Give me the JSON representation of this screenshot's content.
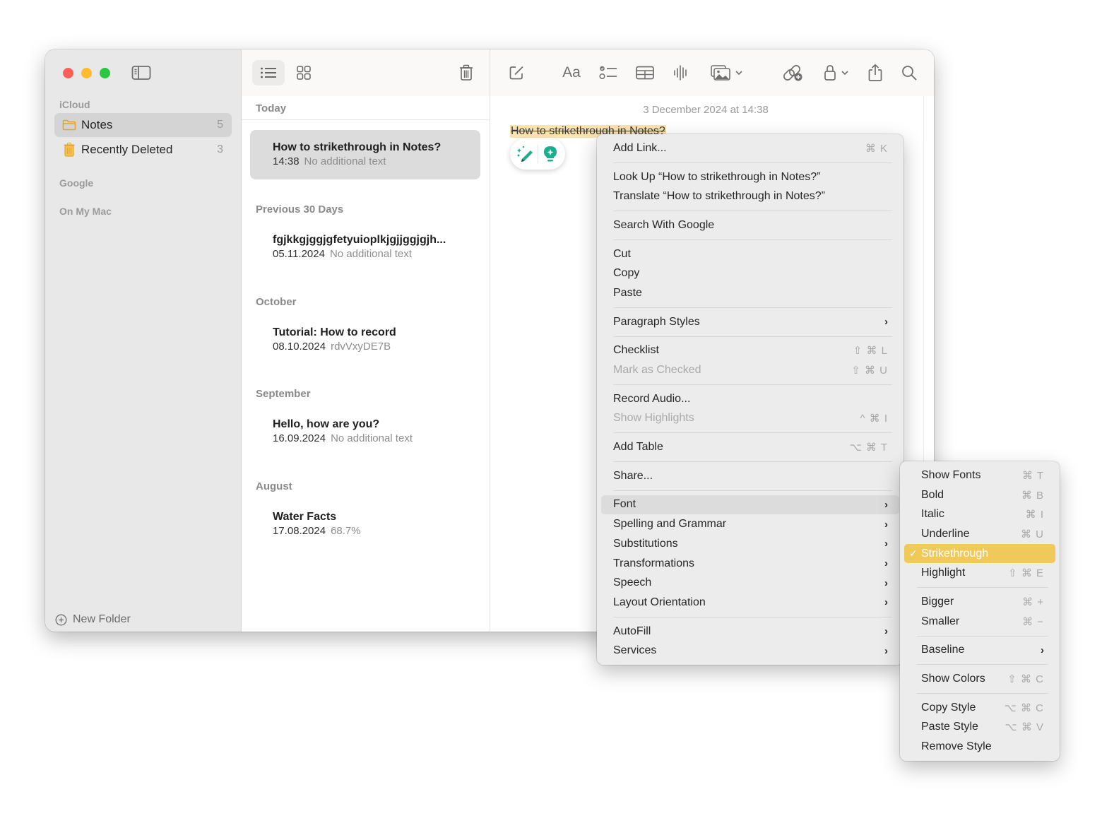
{
  "window": {
    "traffic_lights": [
      "close",
      "minimize",
      "zoom"
    ]
  },
  "sidebar": {
    "sections": [
      {
        "label": "iCloud"
      },
      {
        "label": "Google"
      },
      {
        "label": "On My Mac"
      }
    ],
    "items": [
      {
        "label": "Notes",
        "count": "5",
        "icon": "folder-icon",
        "selected": true
      },
      {
        "label": "Recently Deleted",
        "count": "3",
        "icon": "trash-icon",
        "selected": false
      }
    ],
    "new_folder_label": "New Folder"
  },
  "note_list": {
    "groups": [
      {
        "header": "Today",
        "notes": [
          {
            "title": "How to strikethrough in Notes?",
            "date": "14:38",
            "preview": "No additional text",
            "selected": true
          }
        ]
      },
      {
        "header": "Previous 30 Days",
        "notes": [
          {
            "title": "fgjkkgjggjgfetyuioplkjgjjggjgjh...",
            "date": "05.11.2024",
            "preview": "No additional text"
          }
        ]
      },
      {
        "header": "October",
        "notes": [
          {
            "title": "Tutorial: How to record",
            "date": "08.10.2024",
            "preview": "rdvVxyDE7B"
          }
        ]
      },
      {
        "header": "September",
        "notes": [
          {
            "title": "Hello, how are you?",
            "date": "16.09.2024",
            "preview": "No additional text"
          }
        ]
      },
      {
        "header": "August",
        "notes": [
          {
            "title": "Water Facts",
            "date": "17.08.2024",
            "preview": "68.7%"
          }
        ]
      }
    ]
  },
  "editor": {
    "timestamp": "3 December 2024 at 14:38",
    "body_title": "How to strikethrough in Notes?",
    "highlight_color": "#fbe3b0",
    "writing_tools_color": "#1aae8f"
  },
  "context_menu": {
    "groups": [
      [
        {
          "label": "Add Link...",
          "shortcut": "⌘ K"
        }
      ],
      [
        {
          "label": "Look Up “How to strikethrough in Notes?”"
        },
        {
          "label": "Translate “How to strikethrough in Notes?”"
        }
      ],
      [
        {
          "label": "Search With Google"
        }
      ],
      [
        {
          "label": "Cut"
        },
        {
          "label": "Copy"
        },
        {
          "label": "Paste"
        }
      ],
      [
        {
          "label": "Paragraph Styles",
          "submenu": true
        }
      ],
      [
        {
          "label": "Checklist",
          "shortcut": "⇧ ⌘ L"
        },
        {
          "label": "Mark as Checked",
          "shortcut": "⇧ ⌘ U",
          "disabled": true
        }
      ],
      [
        {
          "label": "Record Audio..."
        },
        {
          "label": "Show Highlights",
          "shortcut": "^ ⌘ I",
          "disabled": true
        }
      ],
      [
        {
          "label": "Add Table",
          "shortcut": "⌥ ⌘ T"
        }
      ],
      [
        {
          "label": "Share..."
        }
      ],
      [
        {
          "label": "Font",
          "submenu": true,
          "hover": true
        },
        {
          "label": "Spelling and Grammar",
          "submenu": true
        },
        {
          "label": "Substitutions",
          "submenu": true
        },
        {
          "label": "Transformations",
          "submenu": true
        },
        {
          "label": "Speech",
          "submenu": true
        },
        {
          "label": "Layout Orientation",
          "submenu": true
        }
      ],
      [
        {
          "label": "AutoFill",
          "submenu": true
        },
        {
          "label": "Services",
          "submenu": true
        }
      ]
    ]
  },
  "font_submenu": {
    "highlight_color": "#f0c95b",
    "groups": [
      [
        {
          "label": "Show Fonts",
          "shortcut": "⌘ T"
        },
        {
          "label": "Bold",
          "shortcut": "⌘ B"
        },
        {
          "label": "Italic",
          "shortcut": "⌘ I"
        },
        {
          "label": "Underline",
          "shortcut": "⌘ U"
        },
        {
          "label": "Strikethrough",
          "checked": true,
          "highlighted": true
        },
        {
          "label": "Highlight",
          "shortcut": "⇧ ⌘ E"
        }
      ],
      [
        {
          "label": "Bigger",
          "shortcut": "⌘ +"
        },
        {
          "label": "Smaller",
          "shortcut": "⌘ −"
        }
      ],
      [
        {
          "label": "Baseline",
          "submenu": true
        }
      ],
      [
        {
          "label": "Show Colors",
          "shortcut": "⇧ ⌘ C"
        }
      ],
      [
        {
          "label": "Copy Style",
          "shortcut": "⌥ ⌘ C"
        },
        {
          "label": "Paste Style",
          "shortcut": "⌥ ⌘ V"
        },
        {
          "label": "Remove Style"
        }
      ]
    ]
  },
  "icons": {
    "check": "✓",
    "arrow": "›"
  }
}
